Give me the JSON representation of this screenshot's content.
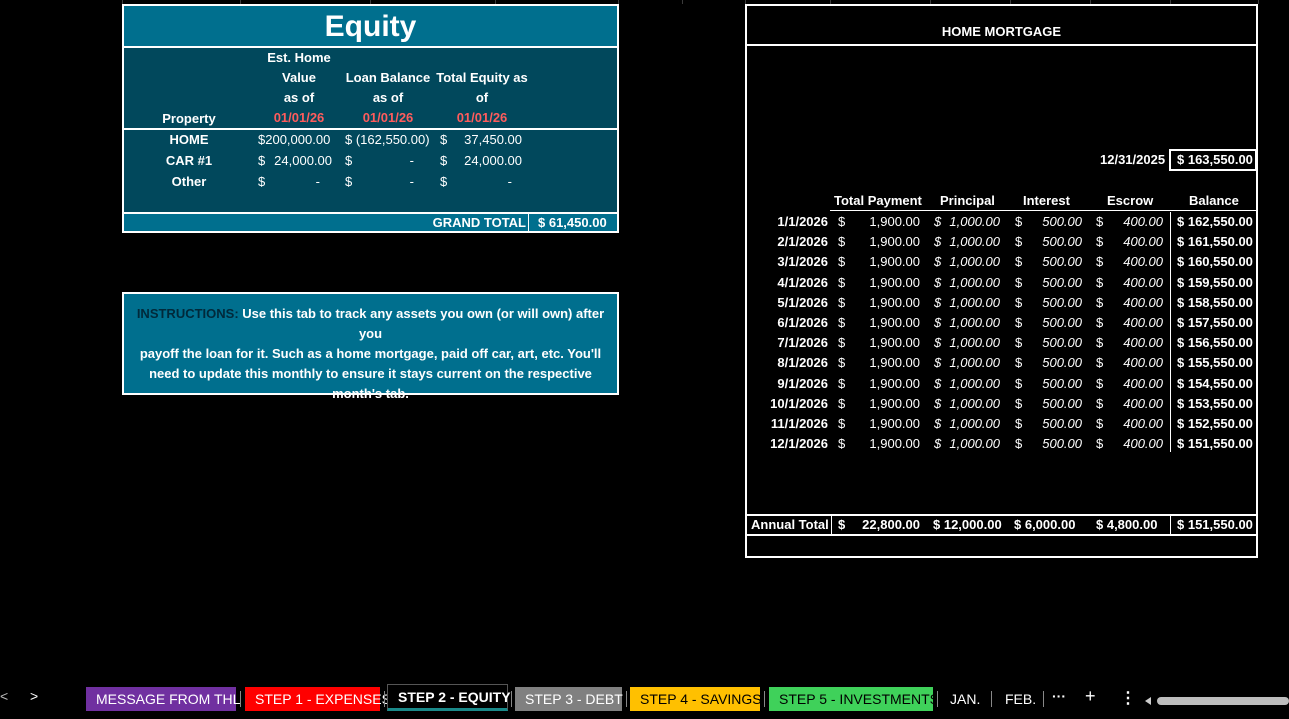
{
  "equity": {
    "title": "Equity",
    "headers": {
      "property": "Property",
      "est_value": [
        "Est. Home",
        "Value",
        "as of",
        "01/01/26"
      ],
      "loan_balance": [
        "Loan Balance",
        "as of",
        "01/01/26"
      ],
      "total_equity": [
        "Total Equity as",
        "of",
        "01/01/26"
      ]
    },
    "rows": [
      {
        "property": "HOME",
        "value": "$200,000.00",
        "loan": "$ (162,550.00)",
        "equity_sym": "$",
        "equity": "37,450.00"
      },
      {
        "property": "CAR #1",
        "value_sym": "$",
        "value": "24,000.00",
        "loan_sym": "$",
        "loan": "-",
        "equity_sym": "$",
        "equity": "24,000.00"
      },
      {
        "property": "Other",
        "value_sym": "$",
        "value": "-",
        "loan_sym": "$",
        "loan": "-",
        "equity_sym": "$",
        "equity": "-"
      }
    ],
    "grand_total_label": "GRAND TOTAL",
    "grand_total_value": "$  61,450.00"
  },
  "instructions": {
    "label": "INSTRUCTIONS:",
    "line1": " Use this tab to track any assets you own (or will own) after you",
    "line2": "payoff the loan for it. Such as a home mortgage, paid off car, art, etc. You'll",
    "line3": "need to update this monthly to ensure it stays current on the respective",
    "line4": "month's tab."
  },
  "mortgage": {
    "title": "HOME MORTGAGE",
    "start_date": "12/31/2025",
    "start_balance": "$ 163,550.00",
    "columns": [
      "Total Payment",
      "Principal",
      "Interest",
      "Escrow",
      "Balance"
    ],
    "rows": [
      {
        "date": "1/1/2026",
        "payment": "1,900.00",
        "principal": "1,000.00",
        "interest": "500.00",
        "escrow": "400.00",
        "balance": "$ 162,550.00"
      },
      {
        "date": "2/1/2026",
        "payment": "1,900.00",
        "principal": "1,000.00",
        "interest": "500.00",
        "escrow": "400.00",
        "balance": "$ 161,550.00"
      },
      {
        "date": "3/1/2026",
        "payment": "1,900.00",
        "principal": "1,000.00",
        "interest": "500.00",
        "escrow": "400.00",
        "balance": "$ 160,550.00"
      },
      {
        "date": "4/1/2026",
        "payment": "1,900.00",
        "principal": "1,000.00",
        "interest": "500.00",
        "escrow": "400.00",
        "balance": "$ 159,550.00"
      },
      {
        "date": "5/1/2026",
        "payment": "1,900.00",
        "principal": "1,000.00",
        "interest": "500.00",
        "escrow": "400.00",
        "balance": "$ 158,550.00"
      },
      {
        "date": "6/1/2026",
        "payment": "1,900.00",
        "principal": "1,000.00",
        "interest": "500.00",
        "escrow": "400.00",
        "balance": "$ 157,550.00"
      },
      {
        "date": "7/1/2026",
        "payment": "1,900.00",
        "principal": "1,000.00",
        "interest": "500.00",
        "escrow": "400.00",
        "balance": "$ 156,550.00"
      },
      {
        "date": "8/1/2026",
        "payment": "1,900.00",
        "principal": "1,000.00",
        "interest": "500.00",
        "escrow": "400.00",
        "balance": "$ 155,550.00"
      },
      {
        "date": "9/1/2026",
        "payment": "1,900.00",
        "principal": "1,000.00",
        "interest": "500.00",
        "escrow": "400.00",
        "balance": "$ 154,550.00"
      },
      {
        "date": "10/1/2026",
        "payment": "1,900.00",
        "principal": "1,000.00",
        "interest": "500.00",
        "escrow": "400.00",
        "balance": "$ 153,550.00"
      },
      {
        "date": "11/1/2026",
        "payment": "1,900.00",
        "principal": "1,000.00",
        "interest": "500.00",
        "escrow": "400.00",
        "balance": "$ 152,550.00"
      },
      {
        "date": "12/1/2026",
        "payment": "1,900.00",
        "principal": "1,000.00",
        "interest": "500.00",
        "escrow": "400.00",
        "balance": "$ 151,550.00"
      }
    ],
    "currency_symbol": "$",
    "annual": {
      "label": "Annual Total",
      "payment": "22,800.00",
      "principal": "$ 12,000.00",
      "interest": "$  6,000.00",
      "escrow": "$  4,800.00",
      "balance": "$ 151,550.00"
    }
  },
  "tabbar": {
    "prev_icon": "chevron-left-icon",
    "next_icon": "chevron-right-icon",
    "prev_glyph": "<",
    "next_glyph": ">",
    "tabs": [
      {
        "label": "MESSAGE FROM THL",
        "color": "#7030a0"
      },
      {
        "label": "STEP 1 - EXPENSES",
        "color": "#ff0000"
      },
      {
        "label": "STEP 2 - EQUITY",
        "color": "#000000",
        "active": true
      },
      {
        "label": "STEP 3 - DEBT",
        "color": "#808080"
      },
      {
        "label": "STEP 4 - SAVINGS",
        "color": "#ffc000"
      },
      {
        "label": "STEP 5 - INVESTMENTS",
        "color": "#3fd15a"
      },
      {
        "label": "JAN.",
        "color": "#000000"
      },
      {
        "label": "FEB.",
        "color": "#000000"
      }
    ],
    "more_glyph": "···",
    "add_glyph": "+",
    "options_glyph": "⋮"
  }
}
